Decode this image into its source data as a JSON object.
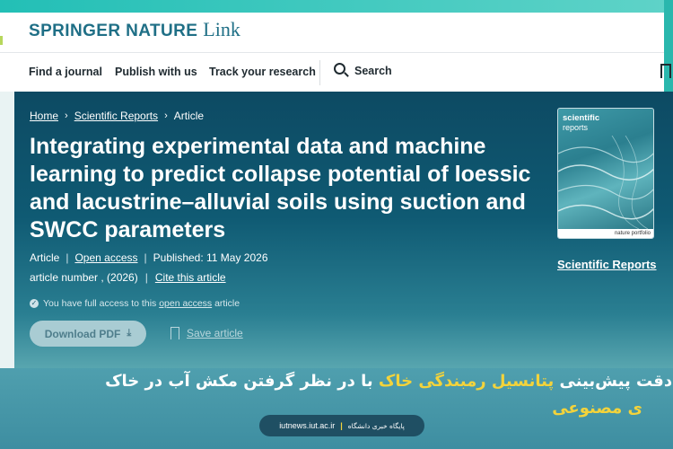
{
  "header": {
    "brand_main": "SPRINGER NATURE",
    "brand_link": "Link",
    "nav": [
      "Find a journal",
      "Publish with us",
      "Track your research"
    ],
    "search_label": "Search"
  },
  "breadcrumb": [
    "Home",
    "Scientific Reports",
    "Article"
  ],
  "article": {
    "title": "Integrating experimental data and machine learning to predict collapse potential of loessic and lacustrine–alluvial soils using suction and SWCC parameters",
    "type": "Article",
    "access": "Open access",
    "published": "Published: 11 May 2026",
    "number": "article number , (2026)",
    "cite": "Cite this article",
    "access_note_pre": "You have full access to this",
    "access_note_link": "open access",
    "access_note_post": "article",
    "download_label": "Download PDF",
    "save_label": "Save article"
  },
  "journal": {
    "cover_title": "scientific",
    "cover_sub": "reports",
    "cover_footer": "nature portfolio",
    "name": "Scientific Reports"
  },
  "banner": {
    "line1_start": "ای دقت پیش‌بینی",
    "line1_highlight": "پتانسیل رمبندگی خاک",
    "line1_end": "با در نظر گرفتن مکش آب در خاک",
    "line2": "ی مصنوعی",
    "news_url": "iutnews.iut.ac.ir",
    "news_label": "پایگاه خبری دانشگاه"
  },
  "colors": {
    "brand": "#1f6f86",
    "hero_dark": "#0d4a63",
    "highlight": "#f3d33b"
  }
}
